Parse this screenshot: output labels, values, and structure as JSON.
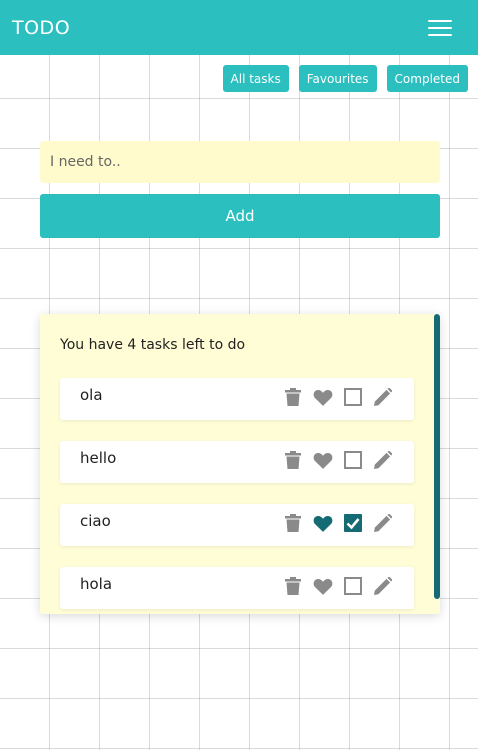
{
  "header": {
    "brand": "TODO",
    "menu_icon": "hamburger-menu-icon"
  },
  "filters": [
    {
      "label": "All tasks"
    },
    {
      "label": "Favourites"
    },
    {
      "label": "Completed"
    }
  ],
  "form": {
    "placeholder": "I need to..",
    "value": "",
    "add_label": "Add"
  },
  "tasks_panel": {
    "summary": "You have 4 tasks left to do",
    "tasks": [
      {
        "label": "ola",
        "favourite": false,
        "completed": false
      },
      {
        "label": "hello",
        "favourite": false,
        "completed": false
      },
      {
        "label": "ciao",
        "favourite": true,
        "completed": true
      },
      {
        "label": "hola",
        "favourite": false,
        "completed": false
      }
    ]
  },
  "colors": {
    "accent": "#2bbfbf",
    "dark_accent": "#156b73",
    "input_bg": "#fffbcc",
    "panel_bg": "#fffdd6",
    "icon_muted": "#8a8a8a"
  }
}
